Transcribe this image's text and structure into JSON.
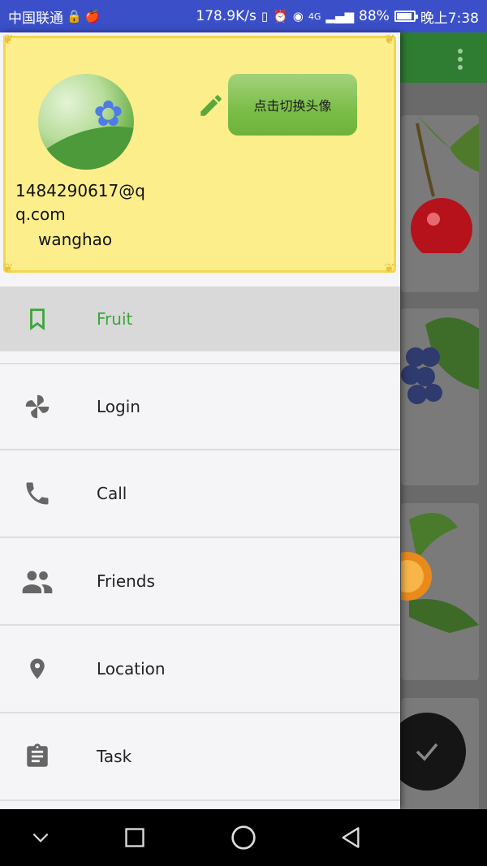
{
  "status_bar": {
    "carrier": "中国联通",
    "network_speed": "178.9K/s",
    "signal_label": "4G",
    "battery": "88%",
    "battery_level": 0.88,
    "time": "晚上7:38"
  },
  "header": {
    "avatar_icon": "flower-avatar",
    "edit_icon": "pencil-icon",
    "switch_avatar_label": "点击切换头像",
    "email": "1484290617@qq.com",
    "username": "wanghao",
    "background_color": "#fdee8c",
    "button_color": "#7abd48"
  },
  "menu": {
    "items": [
      {
        "label": "Fruit",
        "icon": "bookmark-icon",
        "active": true
      },
      {
        "label": "Login",
        "icon": "pinwheel-icon",
        "active": false
      },
      {
        "label": "Call",
        "icon": "phone-icon",
        "active": false
      },
      {
        "label": "Friends",
        "icon": "people-icon",
        "active": false
      },
      {
        "label": "Location",
        "icon": "location-pin-icon",
        "active": false
      },
      {
        "label": "Task",
        "icon": "clipboard-icon",
        "active": false
      }
    ],
    "active_color": "#3aa63a",
    "icon_color": "#666666"
  },
  "app": {
    "toolbar_color": "#2e7d32",
    "fab_icon": "check-icon"
  },
  "nav_bar": {
    "back_icon": "back-triangle-icon",
    "home_icon": "home-circle-icon",
    "recents_icon": "recents-square-icon",
    "collapse_icon": "chevron-down-icon"
  }
}
